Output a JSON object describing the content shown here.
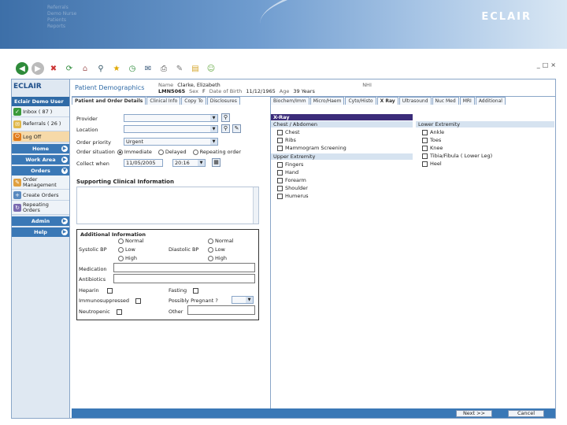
{
  "banner": {
    "brand": "ECLAIR",
    "faded_lines": [
      "Referrals",
      "Demo Nurse",
      "Patients",
      "Reports"
    ]
  },
  "toolbar": {
    "icons": [
      "back-icon",
      "forward-icon",
      "stop-icon",
      "refresh-icon",
      "home-icon",
      "search-icon",
      "favorites-icon",
      "history-icon",
      "mail-icon",
      "print-icon",
      "edit-icon",
      "folder-icon",
      "messenger-icon"
    ]
  },
  "window_controls": [
    "_",
    "□",
    "×"
  ],
  "sidebar": {
    "logo": "ECLAIR",
    "user": "Eclair Demo User",
    "inbox": "Inbox ( 87 )",
    "referrals": "Referrals ( 26 )",
    "logoff": "Log Off",
    "home": "Home",
    "workarea": "Work Area",
    "orders": "Orders",
    "order_mgmt": "Order Management",
    "create_orders": "Create Orders",
    "repeating_orders": "Repeating Orders",
    "admin": "Admin",
    "help": "Help"
  },
  "header": {
    "title": "Patient Demographics",
    "name_label": "Name",
    "name_value": "Clarke, Elizabeth",
    "nhi_label": "NHI",
    "nhi_value": "LMN5065",
    "sex_label": "Sex",
    "sex_value": "F",
    "dob_label": "Date of Birth",
    "dob_value": "11/12/1965",
    "age_label": "Age",
    "age_value": "39 Years"
  },
  "tabs_left": [
    "Patient and Order Details",
    "Clinical Info",
    "Copy To",
    "Disclosures"
  ],
  "tabs_right": [
    "Biochem/Imm",
    "Micro/Haem",
    "Cyto/Histo",
    "X Ray",
    "Ultrasound",
    "Nuc Med",
    "MRI",
    "Additional"
  ],
  "order": {
    "provider_label": "Provider",
    "location_label": "Location",
    "priority_label": "Order priority",
    "priority_value": "Urgent",
    "situation_label": "Order situation",
    "situation_options": [
      "Immediate",
      "Delayed",
      "Repeating order"
    ],
    "collect_label": "Collect when",
    "collect_date": "11/05/2005",
    "collect_time": "20:16",
    "clinical_title": "Supporting Clinical Information"
  },
  "info": {
    "title": "Additional Information",
    "systolic_label": "Systolic BP",
    "diastolic_label": "Diastolic BP",
    "bp_options": [
      "Normal",
      "Low",
      "High"
    ],
    "medication_label": "Medication",
    "antibiotics_label": "Antibiotics",
    "heparin_label": "Heparin",
    "fasting_label": "Fasting",
    "immuno_label": "Immunosuppressed",
    "pregnant_label": "Possibly Pregnant ?",
    "neutropenic_label": "Neutropenic",
    "other_label": "Other"
  },
  "xray": {
    "title": "X-Ray",
    "chest_title": "Chest / Abdomen",
    "chest_items": [
      "Chest",
      "Ribs",
      "Mammogram Screening"
    ],
    "upper_title": "Upper Extremity",
    "upper_items": [
      "Fingers",
      "Hand",
      "Forearm",
      "Shoulder",
      "Humerus"
    ],
    "lower_title": "Lower Extremity",
    "lower_items": [
      "Ankle",
      "Toes",
      "Knee",
      "Tibia/Fibula ( Lower Leg)",
      "Heel"
    ]
  },
  "footer": {
    "next": "Next >>",
    "cancel": "Cancel"
  }
}
